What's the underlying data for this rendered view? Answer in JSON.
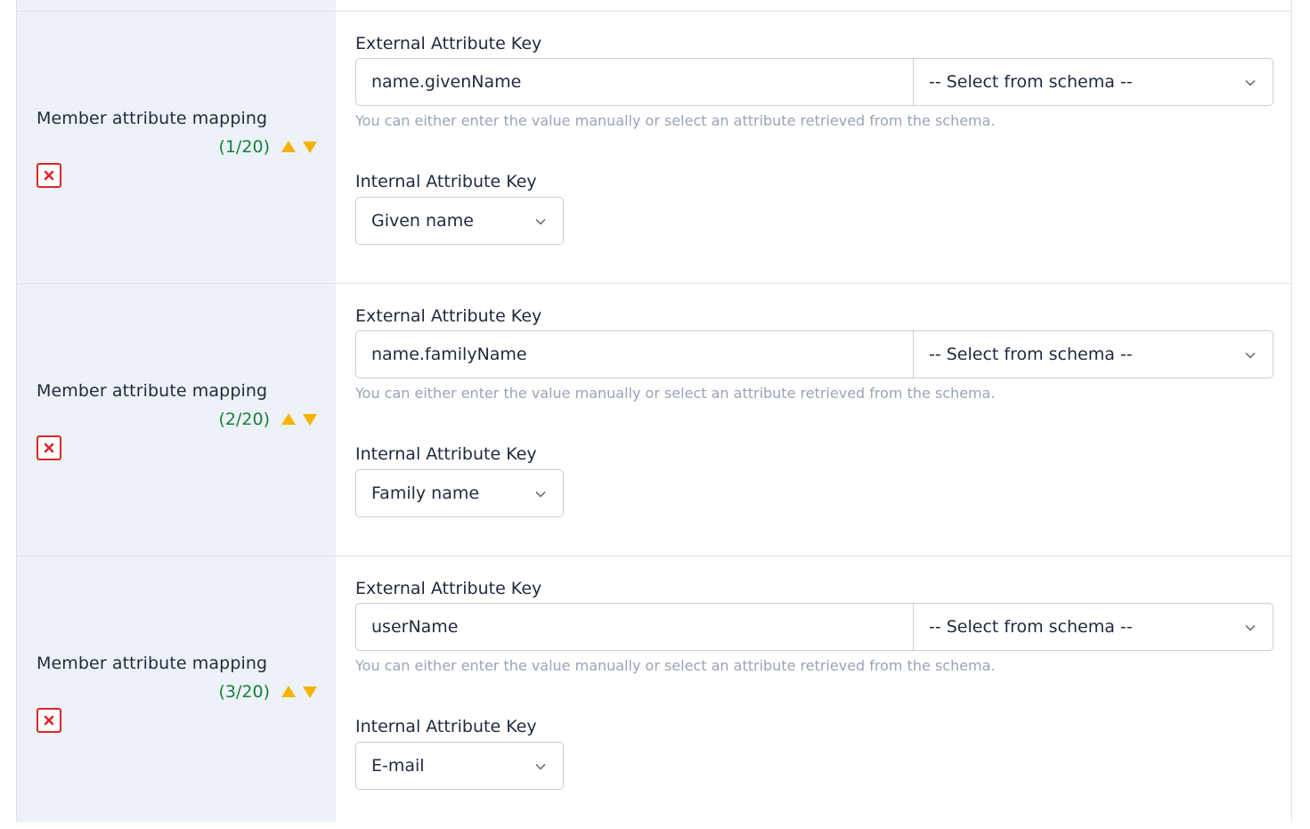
{
  "colors": {
    "counter_green": "#15803d",
    "arrow_amber": "#f5b301",
    "delete_red": "#dc2626",
    "left_panel_bg": "#edf1f8",
    "help_text": "#98a4b8"
  },
  "mappings": [
    {
      "title": "Member attribute mapping",
      "counter": "(1/20)",
      "external_label": "External Attribute Key",
      "external_value": "name.givenName",
      "schema_select": "-- Select from schema --",
      "help": "You can either enter the value manually or select an attribute retrieved from the schema.",
      "internal_label": "Internal Attribute Key",
      "internal_value": "Given name"
    },
    {
      "title": "Member attribute mapping",
      "counter": "(2/20)",
      "external_label": "External Attribute Key",
      "external_value": "name.familyName",
      "schema_select": "-- Select from schema --",
      "help": "You can either enter the value manually or select an attribute retrieved from the schema.",
      "internal_label": "Internal Attribute Key",
      "internal_value": "Family name"
    },
    {
      "title": "Member attribute mapping",
      "counter": "(3/20)",
      "external_label": "External Attribute Key",
      "external_value": "userName",
      "schema_select": "-- Select from schema --",
      "help": "You can either enter the value manually or select an attribute retrieved from the schema.",
      "internal_label": "Internal Attribute Key",
      "internal_value": "E-mail"
    }
  ],
  "icons": {
    "move_up": "triangle-up-icon",
    "move_down": "triangle-down-icon",
    "delete": "close-x-icon",
    "dropdown": "chevron-down-icon"
  }
}
